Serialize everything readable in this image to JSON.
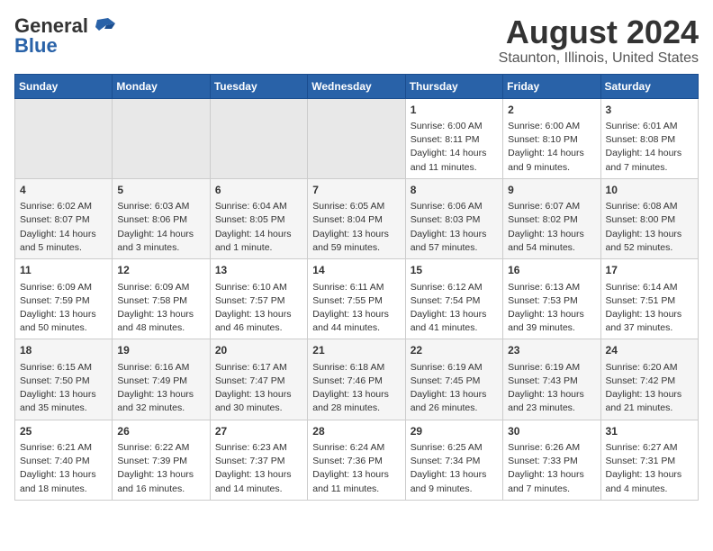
{
  "header": {
    "logo_line1": "General",
    "logo_line2": "Blue",
    "title": "August 2024",
    "subtitle": "Staunton, Illinois, United States"
  },
  "weekdays": [
    "Sunday",
    "Monday",
    "Tuesday",
    "Wednesday",
    "Thursday",
    "Friday",
    "Saturday"
  ],
  "weeks": [
    [
      {
        "day": "",
        "info": ""
      },
      {
        "day": "",
        "info": ""
      },
      {
        "day": "",
        "info": ""
      },
      {
        "day": "",
        "info": ""
      },
      {
        "day": "1",
        "info": "Sunrise: 6:00 AM\nSunset: 8:11 PM\nDaylight: 14 hours\nand 11 minutes."
      },
      {
        "day": "2",
        "info": "Sunrise: 6:00 AM\nSunset: 8:10 PM\nDaylight: 14 hours\nand 9 minutes."
      },
      {
        "day": "3",
        "info": "Sunrise: 6:01 AM\nSunset: 8:08 PM\nDaylight: 14 hours\nand 7 minutes."
      }
    ],
    [
      {
        "day": "4",
        "info": "Sunrise: 6:02 AM\nSunset: 8:07 PM\nDaylight: 14 hours\nand 5 minutes."
      },
      {
        "day": "5",
        "info": "Sunrise: 6:03 AM\nSunset: 8:06 PM\nDaylight: 14 hours\nand 3 minutes."
      },
      {
        "day": "6",
        "info": "Sunrise: 6:04 AM\nSunset: 8:05 PM\nDaylight: 14 hours\nand 1 minute."
      },
      {
        "day": "7",
        "info": "Sunrise: 6:05 AM\nSunset: 8:04 PM\nDaylight: 13 hours\nand 59 minutes."
      },
      {
        "day": "8",
        "info": "Sunrise: 6:06 AM\nSunset: 8:03 PM\nDaylight: 13 hours\nand 57 minutes."
      },
      {
        "day": "9",
        "info": "Sunrise: 6:07 AM\nSunset: 8:02 PM\nDaylight: 13 hours\nand 54 minutes."
      },
      {
        "day": "10",
        "info": "Sunrise: 6:08 AM\nSunset: 8:00 PM\nDaylight: 13 hours\nand 52 minutes."
      }
    ],
    [
      {
        "day": "11",
        "info": "Sunrise: 6:09 AM\nSunset: 7:59 PM\nDaylight: 13 hours\nand 50 minutes."
      },
      {
        "day": "12",
        "info": "Sunrise: 6:09 AM\nSunset: 7:58 PM\nDaylight: 13 hours\nand 48 minutes."
      },
      {
        "day": "13",
        "info": "Sunrise: 6:10 AM\nSunset: 7:57 PM\nDaylight: 13 hours\nand 46 minutes."
      },
      {
        "day": "14",
        "info": "Sunrise: 6:11 AM\nSunset: 7:55 PM\nDaylight: 13 hours\nand 44 minutes."
      },
      {
        "day": "15",
        "info": "Sunrise: 6:12 AM\nSunset: 7:54 PM\nDaylight: 13 hours\nand 41 minutes."
      },
      {
        "day": "16",
        "info": "Sunrise: 6:13 AM\nSunset: 7:53 PM\nDaylight: 13 hours\nand 39 minutes."
      },
      {
        "day": "17",
        "info": "Sunrise: 6:14 AM\nSunset: 7:51 PM\nDaylight: 13 hours\nand 37 minutes."
      }
    ],
    [
      {
        "day": "18",
        "info": "Sunrise: 6:15 AM\nSunset: 7:50 PM\nDaylight: 13 hours\nand 35 minutes."
      },
      {
        "day": "19",
        "info": "Sunrise: 6:16 AM\nSunset: 7:49 PM\nDaylight: 13 hours\nand 32 minutes."
      },
      {
        "day": "20",
        "info": "Sunrise: 6:17 AM\nSunset: 7:47 PM\nDaylight: 13 hours\nand 30 minutes."
      },
      {
        "day": "21",
        "info": "Sunrise: 6:18 AM\nSunset: 7:46 PM\nDaylight: 13 hours\nand 28 minutes."
      },
      {
        "day": "22",
        "info": "Sunrise: 6:19 AM\nSunset: 7:45 PM\nDaylight: 13 hours\nand 26 minutes."
      },
      {
        "day": "23",
        "info": "Sunrise: 6:19 AM\nSunset: 7:43 PM\nDaylight: 13 hours\nand 23 minutes."
      },
      {
        "day": "24",
        "info": "Sunrise: 6:20 AM\nSunset: 7:42 PM\nDaylight: 13 hours\nand 21 minutes."
      }
    ],
    [
      {
        "day": "25",
        "info": "Sunrise: 6:21 AM\nSunset: 7:40 PM\nDaylight: 13 hours\nand 18 minutes."
      },
      {
        "day": "26",
        "info": "Sunrise: 6:22 AM\nSunset: 7:39 PM\nDaylight: 13 hours\nand 16 minutes."
      },
      {
        "day": "27",
        "info": "Sunrise: 6:23 AM\nSunset: 7:37 PM\nDaylight: 13 hours\nand 14 minutes."
      },
      {
        "day": "28",
        "info": "Sunrise: 6:24 AM\nSunset: 7:36 PM\nDaylight: 13 hours\nand 11 minutes."
      },
      {
        "day": "29",
        "info": "Sunrise: 6:25 AM\nSunset: 7:34 PM\nDaylight: 13 hours\nand 9 minutes."
      },
      {
        "day": "30",
        "info": "Sunrise: 6:26 AM\nSunset: 7:33 PM\nDaylight: 13 hours\nand 7 minutes."
      },
      {
        "day": "31",
        "info": "Sunrise: 6:27 AM\nSunset: 7:31 PM\nDaylight: 13 hours\nand 4 minutes."
      }
    ]
  ]
}
